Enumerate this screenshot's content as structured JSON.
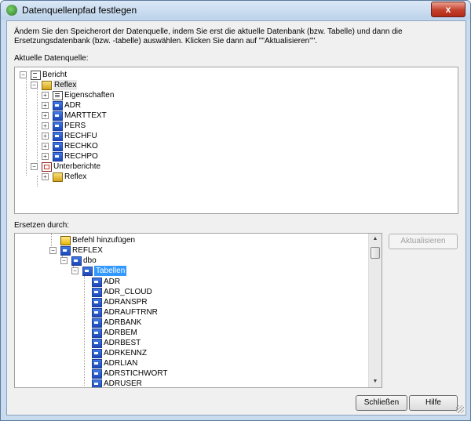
{
  "window": {
    "title": "Datenquellenpfad festlegen",
    "close_label": "x"
  },
  "description": "Ändern Sie den Speicherort der Datenquelle, indem Sie erst die aktuelle Datenbank (bzw. Tabelle) und dann die Ersetzungsdatenbank (bzw. -tabelle) auswählen. Klicken Sie dann auf \"\"Aktualisieren\"\".",
  "current_source": {
    "label": "Aktuelle Datenquelle:",
    "root": "Bericht",
    "reflex": "Reflex",
    "items": [
      "Eigenschaften",
      "ADR",
      "MARTTEXT",
      "PERS",
      "RECHFU",
      "RECHKO",
      "RECHPO"
    ],
    "subreports": "Unterberichte",
    "sub_reflex": "Reflex"
  },
  "replace": {
    "label": "Ersetzen durch:",
    "add_command": "Befehl hinzufügen",
    "db": "REFLEX",
    "schema": "dbo",
    "tables": "Tabellen",
    "table_items": [
      "ADR",
      "ADR_CLOUD",
      "ADRANSPR",
      "ADRAUFTRNR",
      "ADRBANK",
      "ADRBEM",
      "ADRBEST",
      "ADRKENNZ",
      "ADRLIAN",
      "ADRSTICHWORT",
      "ADRUSER"
    ]
  },
  "buttons": {
    "update": "Aktualisieren",
    "close": "Schließen",
    "help": "Hilfe"
  },
  "colors": {
    "selection": "#3399ff",
    "titlebar": "#c9dcef",
    "close": "#c4412b"
  }
}
